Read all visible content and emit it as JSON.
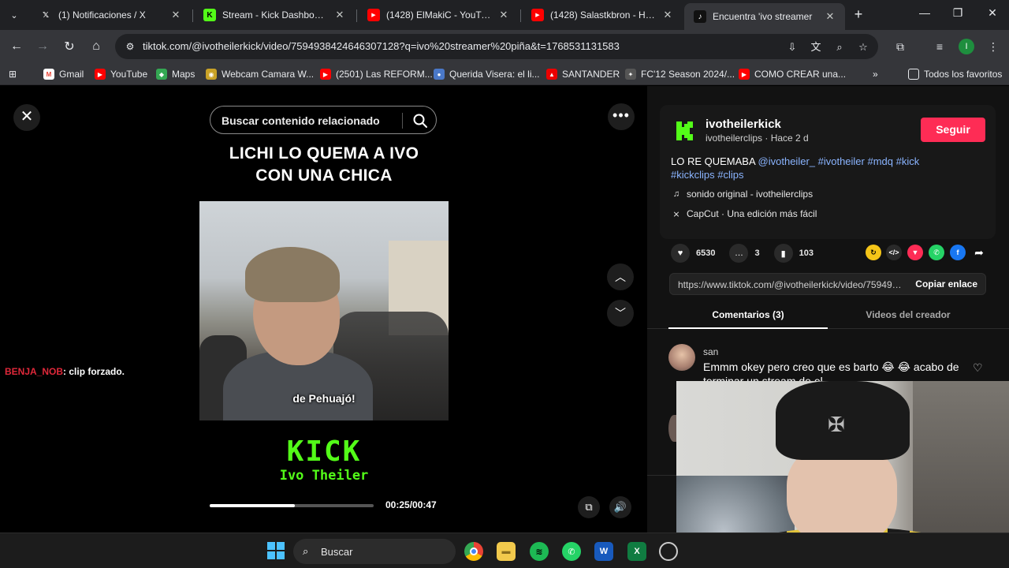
{
  "browser": {
    "tabs": [
      {
        "title": "(1) Notificaciones / X",
        "favicon": "x-icon",
        "fav_color": "#ffffff",
        "fav_text": "X",
        "active": false
      },
      {
        "title": "Stream - Kick Dashboard",
        "favicon": "kick-icon",
        "fav_color": "#53fc18",
        "fav_text": "K",
        "active": false
      },
      {
        "title": "(1428) ElMakiC - YouTube",
        "favicon": "youtube-icon",
        "fav_color": "#ff0000",
        "fav_text": "▶",
        "active": false
      },
      {
        "title": "(1428) Salastkbron - HOLA (",
        "favicon": "youtube-icon",
        "fav_color": "#ff0000",
        "fav_text": "▶",
        "active": false
      },
      {
        "title": "Encuentra 'ivo streamer",
        "favicon": "tiktok-icon",
        "fav_color": "#ffffff",
        "fav_text": "♪",
        "active": true
      }
    ],
    "url": "tiktok.com/@ivotheilerkick/video/7594938424646307128?q=ivo%20streamer%20piña&t=1768531131583",
    "profile_initial": "I",
    "bookmarks": [
      {
        "label": "Gmail",
        "icon": "gmail-icon",
        "color": "#ea4335",
        "glyph": "M"
      },
      {
        "label": "YouTube",
        "icon": "youtube-icon",
        "color": "#ff0000",
        "glyph": "▶"
      },
      {
        "label": "Maps",
        "icon": "maps-icon",
        "color": "#34a853",
        "glyph": "◆"
      },
      {
        "label": "Webcam Camara W...",
        "icon": "webcam-icon",
        "color": "#c9a227",
        "glyph": "◉"
      },
      {
        "label": "(2501) Las REFORM...",
        "icon": "youtube-icon",
        "color": "#ff0000",
        "glyph": "▶"
      },
      {
        "label": "Querida Visera: el li...",
        "icon": "site-icon",
        "color": "#4a78c8",
        "glyph": "●"
      },
      {
        "label": "SANTANDER",
        "icon": "santander-icon",
        "color": "#ec0000",
        "glyph": "▲"
      },
      {
        "label": "FC'12 Season 2024/...",
        "icon": "fc-icon",
        "color": "#8a8a8a",
        "glyph": "⚽"
      },
      {
        "label": "COMO CREAR una...",
        "icon": "youtube-icon",
        "color": "#ff0000",
        "glyph": "▶"
      }
    ],
    "all_bookmarks_label": "Todos los favoritos"
  },
  "video": {
    "search_placeholder": "Buscar contenido relacionado",
    "title_line1": "LICHI LO QUEMA A IVO",
    "title_line2": "CON UNA CHICA",
    "caption": "de Pehuajó!",
    "brand": "KICK",
    "brand_sub": "Ivo Theiler",
    "progress": 0.52,
    "time": "00:25/00:47"
  },
  "chat": {
    "user": "BENJA_NOB",
    "message": ": clip forzado."
  },
  "post": {
    "author": "ivotheilerkick",
    "author_sub": "ivotheilerclips · Hace 2 d",
    "follow_label": "Seguir",
    "desc_text": "LO RE QUEMABA ",
    "desc_tags": "@ivotheiler_ #ivotheiler #mdq #kick #kickclips #clips",
    "sound": "sonido original - ivotheilerclips",
    "capcut": "CapCut · Una edición más fácil",
    "likes": "6530",
    "comments": "3",
    "saves": "103",
    "link": "https://www.tiktok.com/@ivotheilerkick/video/7594938424646307128",
    "copy_label": "Copiar enlace",
    "tab_comments": "Comentarios (3)",
    "tab_creator": "Videos del creador",
    "comment_user": "san",
    "comment_text": "Emmm okey pero creo que es barto 😂 😂 acabo de terminar un stream de el"
  },
  "taskbar": {
    "search_label": "Buscar"
  }
}
